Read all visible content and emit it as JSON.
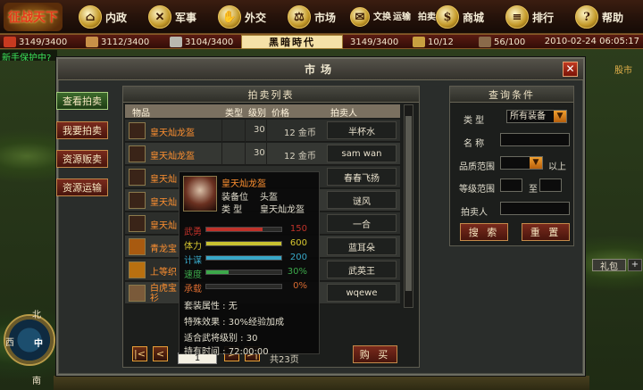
{
  "topbar": {
    "logo_text": "征战天下",
    "nav": [
      {
        "label": "内政",
        "icon": "building-icon"
      },
      {
        "label": "军事",
        "icon": "crossed-swords-icon"
      },
      {
        "label": "外交",
        "icon": "handshake-icon"
      },
      {
        "label": "市场",
        "icon": "scale-icon"
      },
      {
        "label": "文换",
        "icon": "scroll-icon"
      },
      {
        "label": "运输",
        "icon": "cart-icon"
      },
      {
        "label": "拍卖",
        "icon": "gavel-icon"
      },
      {
        "label": "商城",
        "icon": "shop-icon"
      },
      {
        "label": "排行",
        "icon": "ranking-icon"
      },
      {
        "label": "帮助",
        "icon": "book-icon"
      }
    ]
  },
  "resources": {
    "food": "3149/3400",
    "wood": "3112/3400",
    "stone": "3104/3400",
    "era": "黑暗時代",
    "iron": "3149/3400",
    "population": "10/12",
    "gold": "56/100",
    "datetime": "2010-02-24 06:05:17"
  },
  "chat_line": "新手保护中?",
  "market": {
    "title": "市场",
    "side_menu": [
      "查看拍卖",
      "我要拍卖",
      "资源贩卖",
      "资源运输"
    ],
    "auction_list": {
      "title": "拍卖列表",
      "columns": [
        "物品",
        "类型",
        "级别",
        "价格",
        "拍卖人"
      ],
      "rows": [
        {
          "name": "皇天灿龙盔",
          "type": "",
          "level": "30",
          "price": "12 金币",
          "seller": "半杯水"
        },
        {
          "name": "皇天灿龙盔",
          "type": "",
          "level": "30",
          "price": "12 金币",
          "seller": "sam wan"
        },
        {
          "name": "皇天灿",
          "type": "",
          "level": "",
          "price": "",
          "seller": "春春飞扬"
        },
        {
          "name": "皇天灿",
          "type": "",
          "level": "",
          "price": "",
          "seller": "谜风"
        },
        {
          "name": "皇天灿",
          "type": "",
          "level": "",
          "price": "",
          "seller": "一合"
        },
        {
          "name": "青龙宝",
          "type": "",
          "level": "",
          "price": "",
          "seller": "蓝耳朵"
        },
        {
          "name": "上等织",
          "type": "",
          "level": "",
          "price": "",
          "seller": "武英王"
        },
        {
          "name": "白虎宝衫",
          "type": "",
          "level": "",
          "price": "",
          "seller": "wqewe"
        }
      ],
      "page_value": "1",
      "total_pages": "共23页",
      "buy_label": "购 买"
    },
    "tooltip": {
      "name": "皇天灿龙盔",
      "slot_label": "装备位",
      "slot_value": "头盔",
      "type_label": "类 型",
      "type_value": "皇天灿龙盔",
      "stats": [
        {
          "label": "武勇",
          "value": "150",
          "fraction": 0.75,
          "color": "#c0322a"
        },
        {
          "label": "体力",
          "value": "600",
          "fraction": 1.0,
          "color": "#c8c230"
        },
        {
          "label": "计谋",
          "value": "200",
          "fraction": 1.0,
          "color": "#38a8c8"
        },
        {
          "label": "速度",
          "value": "30%",
          "fraction": 0.3,
          "color": "#3ca84a"
        },
        {
          "label": "承载",
          "value": "0%",
          "fraction": 0.0,
          "color": "#777777"
        }
      ],
      "set_attr": "套装属性 : 无",
      "special": "特殊效果 : 30%经验加成",
      "level_req": "适合武将级别 : 30",
      "hold_time": "持有时间 : 72:00:00"
    },
    "query": {
      "title": "查询条件",
      "type_label": "类 型",
      "type_value": "所有装备",
      "name_label": "名 称",
      "quality_label": "品质范围",
      "quality_suffix": "以上",
      "level_label": "等级范围",
      "level_to": "至",
      "seller_label": "拍卖人",
      "search_label": "搜 索",
      "reset_label": "重 置"
    }
  },
  "side": {
    "gift_label": "礼包",
    "right_text": "股市",
    "compass": {
      "north": "北",
      "south": "南",
      "west": "西",
      "center": "中"
    }
  }
}
